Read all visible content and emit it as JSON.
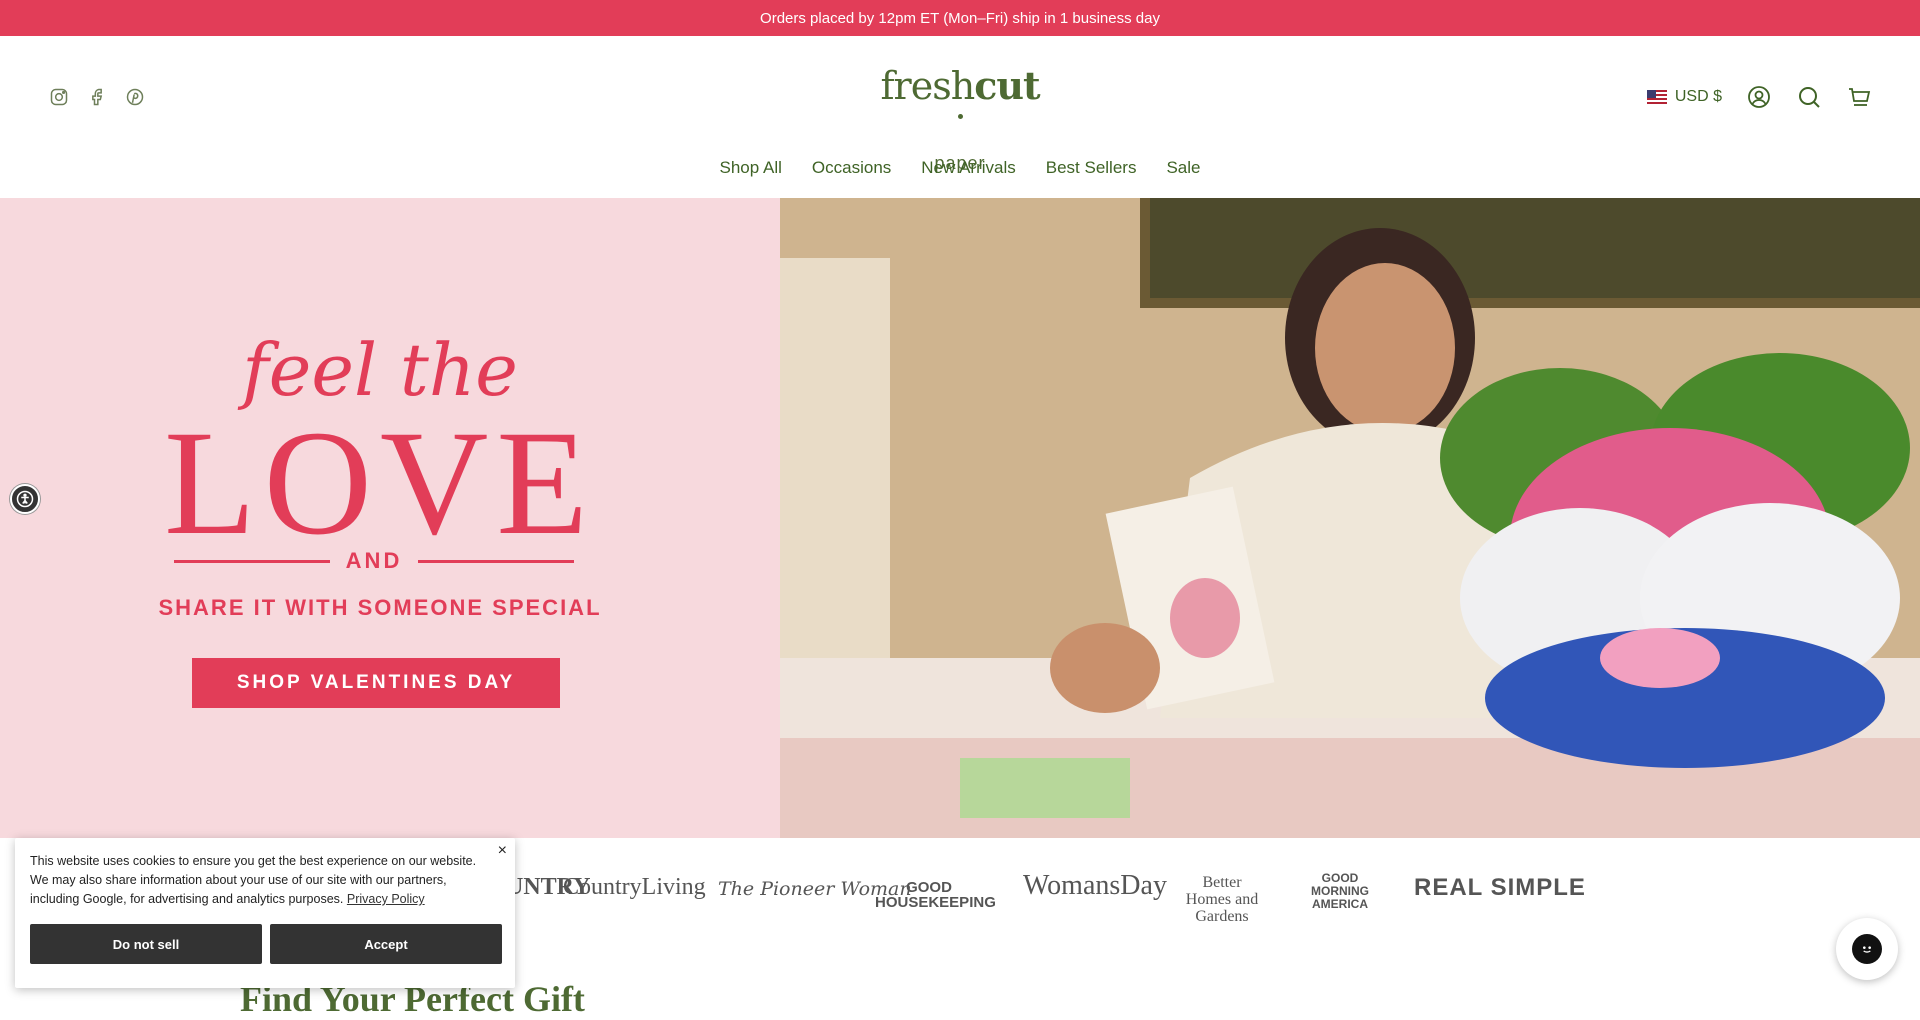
{
  "announcement": "Orders placed by 12pm ET (Mon–Fri) ship in 1 business day",
  "header": {
    "social_icons": [
      "instagram-icon",
      "facebook-icon",
      "pinterest-icon"
    ],
    "logo_fresh": "fresh",
    "logo_cut": "cut",
    "logo_sub": "paper",
    "currency": "USD $",
    "tool_icons": [
      "account-icon",
      "search-icon",
      "cart-icon"
    ]
  },
  "nav": {
    "items": [
      {
        "label": "Shop All"
      },
      {
        "label": "Occasions"
      },
      {
        "label": "New Arrivals"
      },
      {
        "label": "Best Sellers"
      },
      {
        "label": "Sale"
      }
    ]
  },
  "hero": {
    "feel": "feel the",
    "love": "LOVE",
    "and": "AND",
    "share": "SHARE IT WITH SOMEONE SPECIAL",
    "cta": "SHOP VALENTINES DAY"
  },
  "press": {
    "logos": [
      "COUNTRY",
      "CountryLiving",
      "The Pioneer Woman",
      "GOOD HOUSEKEEPING",
      "WomansDay",
      "Better Homes and Gardens",
      "GOOD MORNING AMERICA",
      "REAL SIMPLE"
    ]
  },
  "find_heading": "Find Your Perfect Gift",
  "cookie": {
    "text": "This website uses cookies to ensure you get the best experience on our website. We may also share information about your use of our site with our partners, including Google, for advertising and analytics purposes.",
    "link": "Privacy Policy",
    "close": "×",
    "do_not_sell": "Do not sell",
    "accept": "Accept"
  },
  "colors": {
    "brand_red": "#e23d58",
    "brand_green": "#4e6a33",
    "hero_pink": "#f7d9dd"
  }
}
